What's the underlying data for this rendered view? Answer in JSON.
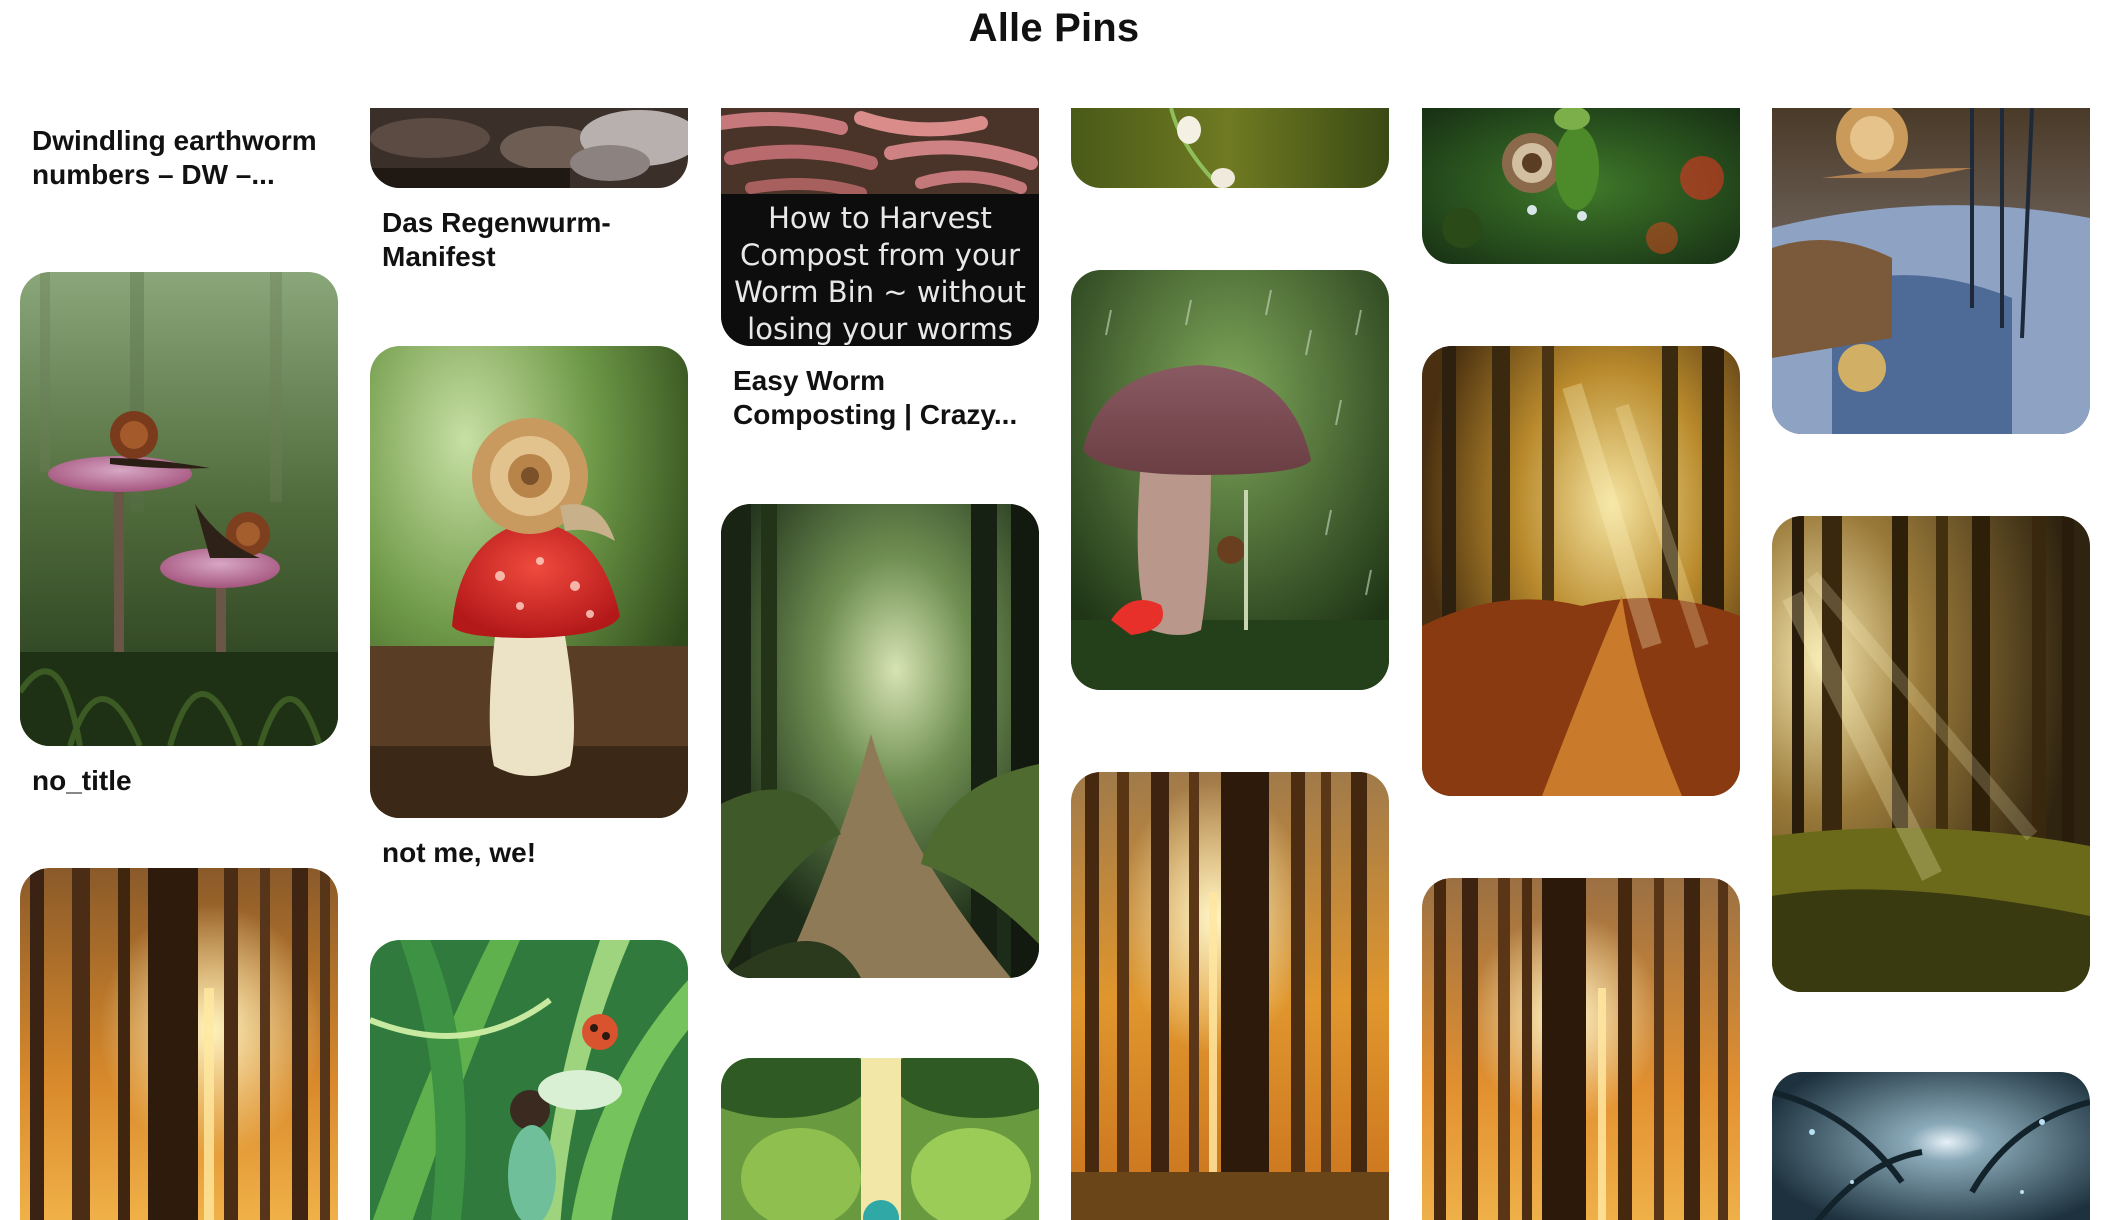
{
  "header": {
    "title": "Alle Pins"
  },
  "pins": [
    {
      "title": "Dwindling earthworm numbers – DW –...",
      "image": "light-gray-pin"
    },
    {
      "title": "no_title",
      "image": "snails-on-pink-mushrooms"
    },
    {
      "title": "",
      "image": "sunlit-pine-forest"
    },
    {
      "title": "Das Regenwurm-Manifest",
      "image": "earthworms-in-soil"
    },
    {
      "title": "not me, we!",
      "image": "snail-on-red-toadstool"
    },
    {
      "title": "",
      "image": "anime-girl-in-jungle-leaves"
    },
    {
      "title": "Easy Worm Composting | Crazy...",
      "image": "worms-compost",
      "overlay": [
        "How to Harvest",
        "Compost from your",
        "Worm Bin ~ without",
        "losing your worms"
      ]
    },
    {
      "title": "",
      "image": "misty-forest-path"
    },
    {
      "title": "",
      "image": "illustrated-jungle"
    },
    {
      "title": "",
      "image": "lily-of-the-valley"
    },
    {
      "title": "",
      "image": "mushroom-with-snail-in-rain"
    },
    {
      "title": "",
      "image": "sunlit-pine-forest"
    },
    {
      "title": "",
      "image": "snail-on-green-bud"
    },
    {
      "title": "",
      "image": "autumn-forest-path-sunbeams"
    },
    {
      "title": "",
      "image": "sunlit-pine-forest"
    },
    {
      "title": "",
      "image": "snail-by-puddle"
    },
    {
      "title": "",
      "image": "forest-sun-rays"
    },
    {
      "title": "",
      "image": "moonlit-dark-forest"
    }
  ]
}
